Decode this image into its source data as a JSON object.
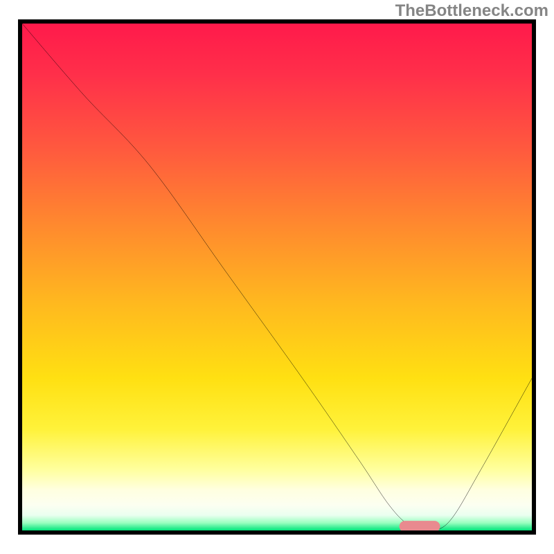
{
  "watermark": "TheBottleneck.com",
  "chart_data": {
    "type": "line",
    "title": "",
    "xlabel": "",
    "ylabel": "",
    "xlim": [
      0,
      100
    ],
    "ylim": [
      0,
      100
    ],
    "grid": false,
    "legend": false,
    "gradient_stops": [
      {
        "pos": 0,
        "color": "#ff1a4b"
      },
      {
        "pos": 25,
        "color": "#ff5a3e"
      },
      {
        "pos": 55,
        "color": "#ffb81f"
      },
      {
        "pos": 80,
        "color": "#fff23a"
      },
      {
        "pos": 95,
        "color": "#fcfff1"
      },
      {
        "pos": 100,
        "color": "#00e37a"
      }
    ],
    "series": [
      {
        "name": "bottleneck-curve",
        "color": "#000000",
        "x": [
          0,
          12,
          25,
          40,
          55,
          66,
          72,
          76,
          80,
          84,
          90,
          100
        ],
        "y": [
          100,
          86,
          72,
          51,
          30,
          14,
          5,
          1,
          0,
          2,
          12,
          30
        ]
      }
    ],
    "marker": {
      "name": "optimal-marker",
      "color": "#e98a8f",
      "x_start": 74,
      "x_end": 82,
      "y": 0.8,
      "thickness": 2.2
    }
  }
}
